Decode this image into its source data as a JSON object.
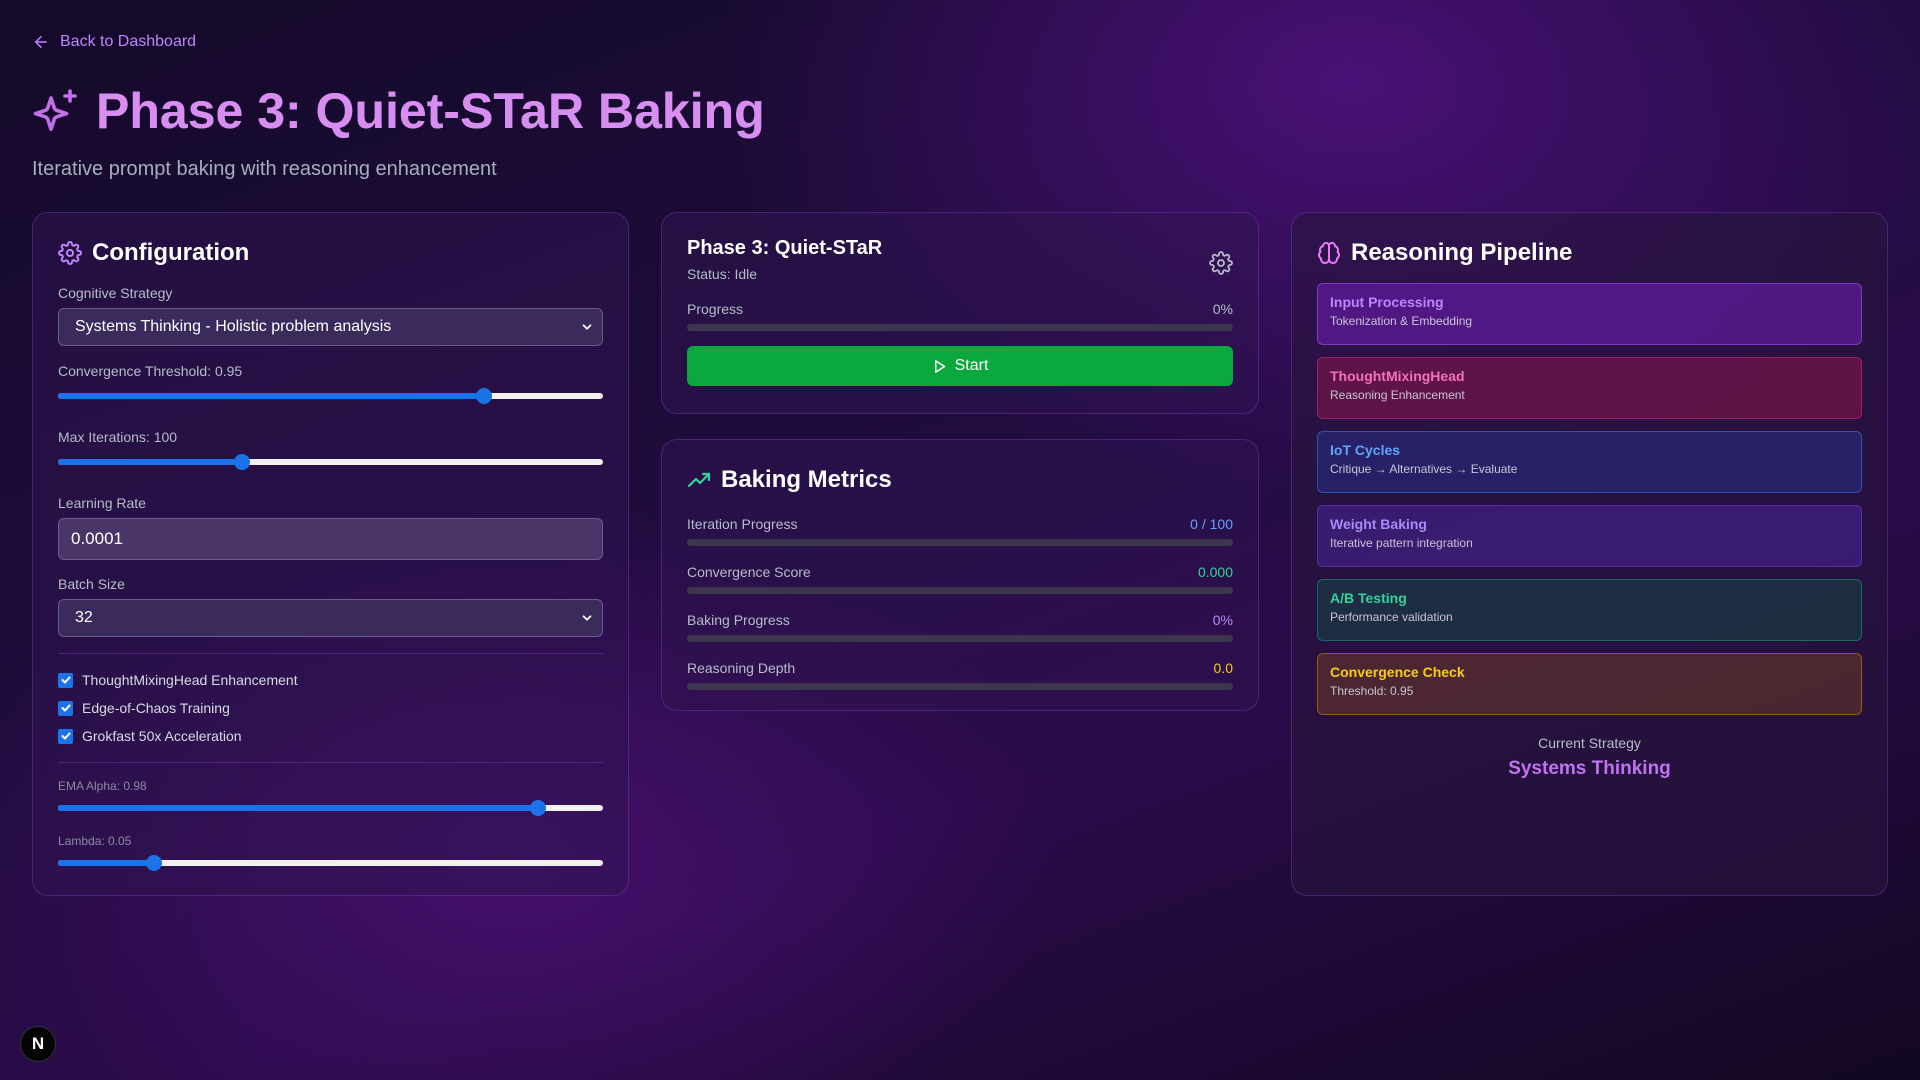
{
  "nav": {
    "back_label": "Back to Dashboard"
  },
  "header": {
    "title": "Phase 3: Quiet-STaR Baking",
    "subtitle": "Iterative prompt baking with reasoning enhancement"
  },
  "config": {
    "title": "Configuration",
    "strategy_label": "Cognitive Strategy",
    "strategy_value": "Systems Thinking - Holistic problem analysis",
    "convergence_label": "Convergence Threshold: 0.95",
    "convergence_fraction": 0.782,
    "max_iter_label": "Max Iterations: 100",
    "max_iter_fraction": 0.337,
    "lr_label": "Learning Rate",
    "lr_value": "0.0001",
    "batch_label": "Batch Size",
    "batch_value": "32",
    "checks": [
      {
        "label": "ThoughtMixingHead Enhancement",
        "checked": true
      },
      {
        "label": "Edge-of-Chaos Training",
        "checked": true
      },
      {
        "label": "Grokfast 50x Acceleration",
        "checked": true
      }
    ],
    "ema_label": "EMA Alpha: 0.98",
    "ema_fraction": 0.88,
    "lambda_label": "Lambda: 0.05",
    "lambda_fraction": 0.176
  },
  "phase": {
    "title": "Phase 3: Quiet-STaR",
    "status": "Status: Idle",
    "progress_label": "Progress",
    "progress_value": "0%",
    "progress_fraction": 0,
    "start_label": "Start"
  },
  "metrics": {
    "title": "Baking Metrics",
    "items": [
      {
        "label": "Iteration Progress",
        "value": "0 / 100",
        "color": "#60a5fa",
        "fraction": 0
      },
      {
        "label": "Convergence Score",
        "value": "0.000",
        "color": "#34d399",
        "fraction": 0
      },
      {
        "label": "Baking Progress",
        "value": "0%",
        "color": "#c084fc",
        "fraction": 0
      },
      {
        "label": "Reasoning Depth",
        "value": "0.0",
        "color": "#facc15",
        "fraction": 0
      }
    ]
  },
  "pipeline": {
    "title": "Reasoning Pipeline",
    "stages": [
      {
        "name": "Input Processing",
        "desc": "Tokenization & Embedding",
        "color": "#c084fc",
        "bg": "rgba(126, 34, 206, 0.45)",
        "border": "rgba(168, 85, 247, 0.55)"
      },
      {
        "name": "ThoughtMixingHead",
        "desc": "Reasoning Enhancement",
        "color": "#f472b6",
        "bg": "rgba(157, 23, 77, 0.45)",
        "border": "rgba(219, 39, 119, 0.55)"
      },
      {
        "name": "IoT Cycles",
        "desc": "Critique → Alternatives → Evaluate",
        "color": "#60a5fa",
        "bg": "rgba(37, 50, 140, 0.5)",
        "border": "rgba(59, 130, 246, 0.5)"
      },
      {
        "name": "Weight Baking",
        "desc": "Iterative pattern integration",
        "color": "#a78bfa",
        "bg": "rgba(76, 40, 160, 0.5)",
        "border": "rgba(124, 58, 237, 0.5)"
      },
      {
        "name": "A/B Testing",
        "desc": "Performance validation",
        "color": "#34d399",
        "bg": "rgba(20, 70, 70, 0.55)",
        "border": "rgba(16, 185, 129, 0.45)"
      },
      {
        "name": "Convergence Check",
        "desc": "Threshold: 0.95",
        "color": "#facc15",
        "bg": "rgba(100, 55, 40, 0.6)",
        "border": "rgba(202, 138, 4, 0.55)"
      }
    ],
    "current_label": "Current Strategy",
    "current_value": "Systems Thinking"
  },
  "badge": {
    "letter": "N"
  }
}
